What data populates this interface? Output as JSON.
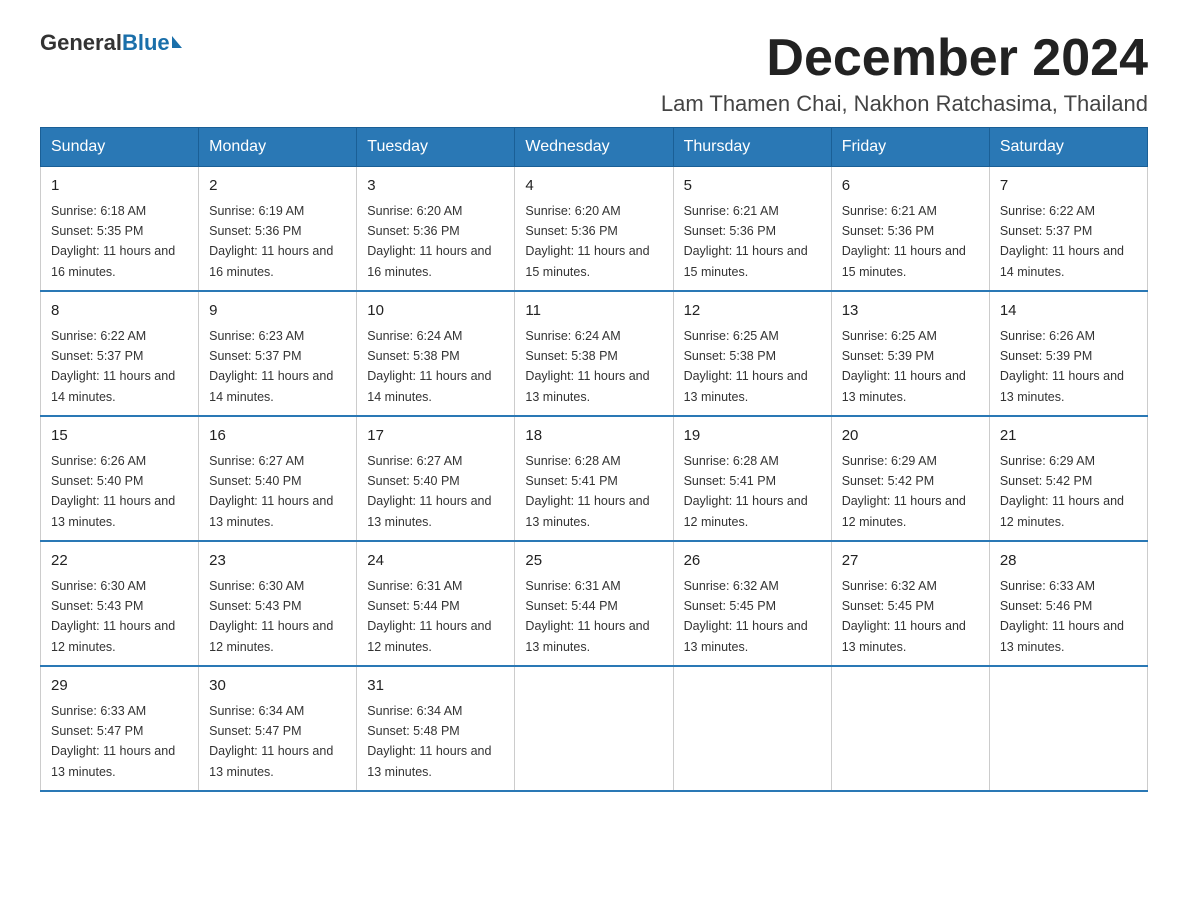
{
  "logo": {
    "general": "General",
    "blue": "Blue"
  },
  "title": {
    "month": "December 2024",
    "location": "Lam Thamen Chai, Nakhon Ratchasima, Thailand"
  },
  "headers": [
    "Sunday",
    "Monday",
    "Tuesday",
    "Wednesday",
    "Thursday",
    "Friday",
    "Saturday"
  ],
  "weeks": [
    [
      {
        "day": "1",
        "sunrise": "6:18 AM",
        "sunset": "5:35 PM",
        "daylight": "11 hours and 16 minutes."
      },
      {
        "day": "2",
        "sunrise": "6:19 AM",
        "sunset": "5:36 PM",
        "daylight": "11 hours and 16 minutes."
      },
      {
        "day": "3",
        "sunrise": "6:20 AM",
        "sunset": "5:36 PM",
        "daylight": "11 hours and 16 minutes."
      },
      {
        "day": "4",
        "sunrise": "6:20 AM",
        "sunset": "5:36 PM",
        "daylight": "11 hours and 15 minutes."
      },
      {
        "day": "5",
        "sunrise": "6:21 AM",
        "sunset": "5:36 PM",
        "daylight": "11 hours and 15 minutes."
      },
      {
        "day": "6",
        "sunrise": "6:21 AM",
        "sunset": "5:36 PM",
        "daylight": "11 hours and 15 minutes."
      },
      {
        "day": "7",
        "sunrise": "6:22 AM",
        "sunset": "5:37 PM",
        "daylight": "11 hours and 14 minutes."
      }
    ],
    [
      {
        "day": "8",
        "sunrise": "6:22 AM",
        "sunset": "5:37 PM",
        "daylight": "11 hours and 14 minutes."
      },
      {
        "day": "9",
        "sunrise": "6:23 AM",
        "sunset": "5:37 PM",
        "daylight": "11 hours and 14 minutes."
      },
      {
        "day": "10",
        "sunrise": "6:24 AM",
        "sunset": "5:38 PM",
        "daylight": "11 hours and 14 minutes."
      },
      {
        "day": "11",
        "sunrise": "6:24 AM",
        "sunset": "5:38 PM",
        "daylight": "11 hours and 13 minutes."
      },
      {
        "day": "12",
        "sunrise": "6:25 AM",
        "sunset": "5:38 PM",
        "daylight": "11 hours and 13 minutes."
      },
      {
        "day": "13",
        "sunrise": "6:25 AM",
        "sunset": "5:39 PM",
        "daylight": "11 hours and 13 minutes."
      },
      {
        "day": "14",
        "sunrise": "6:26 AM",
        "sunset": "5:39 PM",
        "daylight": "11 hours and 13 minutes."
      }
    ],
    [
      {
        "day": "15",
        "sunrise": "6:26 AM",
        "sunset": "5:40 PM",
        "daylight": "11 hours and 13 minutes."
      },
      {
        "day": "16",
        "sunrise": "6:27 AM",
        "sunset": "5:40 PM",
        "daylight": "11 hours and 13 minutes."
      },
      {
        "day": "17",
        "sunrise": "6:27 AM",
        "sunset": "5:40 PM",
        "daylight": "11 hours and 13 minutes."
      },
      {
        "day": "18",
        "sunrise": "6:28 AM",
        "sunset": "5:41 PM",
        "daylight": "11 hours and 13 minutes."
      },
      {
        "day": "19",
        "sunrise": "6:28 AM",
        "sunset": "5:41 PM",
        "daylight": "11 hours and 12 minutes."
      },
      {
        "day": "20",
        "sunrise": "6:29 AM",
        "sunset": "5:42 PM",
        "daylight": "11 hours and 12 minutes."
      },
      {
        "day": "21",
        "sunrise": "6:29 AM",
        "sunset": "5:42 PM",
        "daylight": "11 hours and 12 minutes."
      }
    ],
    [
      {
        "day": "22",
        "sunrise": "6:30 AM",
        "sunset": "5:43 PM",
        "daylight": "11 hours and 12 minutes."
      },
      {
        "day": "23",
        "sunrise": "6:30 AM",
        "sunset": "5:43 PM",
        "daylight": "11 hours and 12 minutes."
      },
      {
        "day": "24",
        "sunrise": "6:31 AM",
        "sunset": "5:44 PM",
        "daylight": "11 hours and 12 minutes."
      },
      {
        "day": "25",
        "sunrise": "6:31 AM",
        "sunset": "5:44 PM",
        "daylight": "11 hours and 13 minutes."
      },
      {
        "day": "26",
        "sunrise": "6:32 AM",
        "sunset": "5:45 PM",
        "daylight": "11 hours and 13 minutes."
      },
      {
        "day": "27",
        "sunrise": "6:32 AM",
        "sunset": "5:45 PM",
        "daylight": "11 hours and 13 minutes."
      },
      {
        "day": "28",
        "sunrise": "6:33 AM",
        "sunset": "5:46 PM",
        "daylight": "11 hours and 13 minutes."
      }
    ],
    [
      {
        "day": "29",
        "sunrise": "6:33 AM",
        "sunset": "5:47 PM",
        "daylight": "11 hours and 13 minutes."
      },
      {
        "day": "30",
        "sunrise": "6:34 AM",
        "sunset": "5:47 PM",
        "daylight": "11 hours and 13 minutes."
      },
      {
        "day": "31",
        "sunrise": "6:34 AM",
        "sunset": "5:48 PM",
        "daylight": "11 hours and 13 minutes."
      },
      null,
      null,
      null,
      null
    ]
  ]
}
